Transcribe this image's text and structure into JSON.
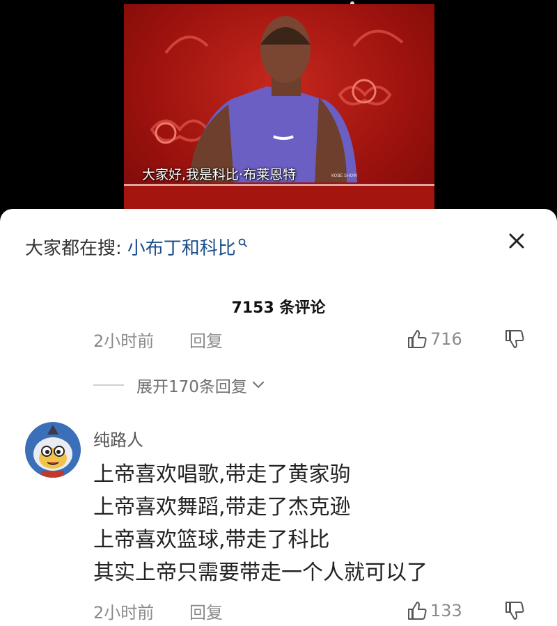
{
  "video": {
    "subtitle": "大家好,我是科比·布莱恩特",
    "watermark": "KOBE SHOW"
  },
  "search_hint": {
    "prefix": "大家都在搜:",
    "term": "小布丁和科比"
  },
  "comments_header": {
    "count_text": "7153 条评论"
  },
  "top_comment_meta": {
    "time": "2小时前",
    "reply_label": "回复",
    "likes": "716"
  },
  "expand_replies": {
    "label": "展开170条回复"
  },
  "comment": {
    "username": "纯路人",
    "lines": [
      "上帝喜欢唱歌,带走了黄家驹",
      "上帝喜欢舞蹈,带走了杰克逊",
      "上帝喜欢篮球,带走了科比",
      "其实上帝只需要带走一个人就可以了"
    ],
    "time": "2小时前",
    "reply_label": "回复",
    "likes": "133"
  },
  "icons": {
    "close": "close-icon",
    "search": "search-icon",
    "like": "thumbs-up-icon",
    "dislike": "thumbs-down-icon",
    "expand": "chevron-down-icon"
  }
}
